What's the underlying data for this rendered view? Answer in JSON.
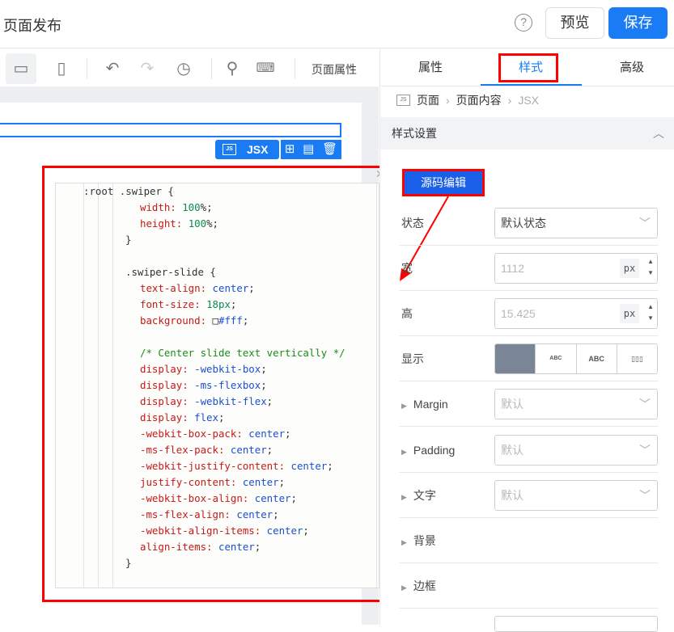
{
  "header": {
    "title": "页面发布",
    "help": "?",
    "preview": "预览",
    "save": "保存"
  },
  "toolbar": {
    "page_props": "页面属性"
  },
  "canvas": {
    "jsx_label": "JSX",
    "js_badge": "JS"
  },
  "editor": {
    "lines": [
      [
        {
          "t": ":root .swiper {",
          "c": "sel",
          "i": 0
        }
      ],
      [
        {
          "t": "width: ",
          "c": "prop",
          "i": 2
        },
        {
          "t": "100",
          "c": "num"
        },
        {
          "t": "%;",
          "c": "sel"
        }
      ],
      [
        {
          "t": "height: ",
          "c": "prop",
          "i": 2
        },
        {
          "t": "100",
          "c": "num"
        },
        {
          "t": "%;",
          "c": "sel"
        }
      ],
      [
        {
          "t": "}",
          "c": "sel",
          "i": 1
        }
      ],
      [
        {
          "t": "",
          "c": "sel",
          "i": 0
        }
      ],
      [
        {
          "t": ".swiper-slide {",
          "c": "sel",
          "i": 1
        }
      ],
      [
        {
          "t": "text-align: ",
          "c": "prop",
          "i": 2
        },
        {
          "t": "center",
          "c": "val"
        },
        {
          "t": ";",
          "c": "sel"
        }
      ],
      [
        {
          "t": "font-size: ",
          "c": "prop",
          "i": 2
        },
        {
          "t": "18px",
          "c": "num"
        },
        {
          "t": ";",
          "c": "sel"
        }
      ],
      [
        {
          "t": "background: ",
          "c": "prop",
          "i": 2
        },
        {
          "t": "□",
          "c": "sel"
        },
        {
          "t": "#fff",
          "c": "val"
        },
        {
          "t": ";",
          "c": "sel"
        }
      ],
      [
        {
          "t": "",
          "c": "sel",
          "i": 0
        }
      ],
      [
        {
          "t": "/* Center slide text vertically */",
          "c": "cmt",
          "i": 2
        }
      ],
      [
        {
          "t": "display: ",
          "c": "prop",
          "i": 2
        },
        {
          "t": "-webkit-box",
          "c": "val"
        },
        {
          "t": ";",
          "c": "sel"
        }
      ],
      [
        {
          "t": "display: ",
          "c": "prop",
          "i": 2
        },
        {
          "t": "-ms-flexbox",
          "c": "val"
        },
        {
          "t": ";",
          "c": "sel"
        }
      ],
      [
        {
          "t": "display: ",
          "c": "prop",
          "i": 2
        },
        {
          "t": "-webkit-flex",
          "c": "val"
        },
        {
          "t": ";",
          "c": "sel"
        }
      ],
      [
        {
          "t": "display: ",
          "c": "prop",
          "i": 2
        },
        {
          "t": "flex",
          "c": "val"
        },
        {
          "t": ";",
          "c": "sel"
        }
      ],
      [
        {
          "t": "-webkit-box-pack: ",
          "c": "prop",
          "i": 2
        },
        {
          "t": "center",
          "c": "val"
        },
        {
          "t": ";",
          "c": "sel"
        }
      ],
      [
        {
          "t": "-ms-flex-pack: ",
          "c": "prop",
          "i": 2
        },
        {
          "t": "center",
          "c": "val"
        },
        {
          "t": ";",
          "c": "sel"
        }
      ],
      [
        {
          "t": "-webkit-justify-content: ",
          "c": "prop",
          "i": 2
        },
        {
          "t": "center",
          "c": "val"
        },
        {
          "t": ";",
          "c": "sel"
        }
      ],
      [
        {
          "t": "justify-content: ",
          "c": "prop",
          "i": 2
        },
        {
          "t": "center",
          "c": "val"
        },
        {
          "t": ";",
          "c": "sel"
        }
      ],
      [
        {
          "t": "-webkit-box-align: ",
          "c": "prop",
          "i": 2
        },
        {
          "t": "center",
          "c": "val"
        },
        {
          "t": ";",
          "c": "sel"
        }
      ],
      [
        {
          "t": "-ms-flex-align: ",
          "c": "prop",
          "i": 2
        },
        {
          "t": "center",
          "c": "val"
        },
        {
          "t": ";",
          "c": "sel"
        }
      ],
      [
        {
          "t": "-webkit-align-items: ",
          "c": "prop",
          "i": 2
        },
        {
          "t": "center",
          "c": "val"
        },
        {
          "t": ";",
          "c": "sel"
        }
      ],
      [
        {
          "t": "align-items: ",
          "c": "prop",
          "i": 2
        },
        {
          "t": "center",
          "c": "val"
        },
        {
          "t": ";",
          "c": "sel"
        }
      ],
      [
        {
          "t": "}",
          "c": "sel",
          "i": 1
        }
      ]
    ]
  },
  "panel": {
    "tabs": [
      "属性",
      "样式",
      "高级"
    ],
    "breadcrumb": [
      "页面",
      "页面内容",
      "JSX"
    ],
    "section": "样式设置",
    "source_edit": "源码编辑",
    "state": {
      "label": "状态",
      "value": "默认状态"
    },
    "width": {
      "label": "宽",
      "value": "1112",
      "unit": "px"
    },
    "height": {
      "label": "高",
      "value": "15.425",
      "unit": "px"
    },
    "display": {
      "label": "显示",
      "options": [
        "",
        "ABC",
        "ABC",
        "▯▯▯"
      ]
    },
    "margin": {
      "label": "Margin",
      "value": "默认"
    },
    "padding": {
      "label": "Padding",
      "value": "默认"
    },
    "text": {
      "label": "文字",
      "value": "默认"
    },
    "background": {
      "label": "背景"
    },
    "border": {
      "label": "边框"
    }
  },
  "colors": {
    "accent": "#1a7cf5",
    "annotation": "#ff0000"
  }
}
